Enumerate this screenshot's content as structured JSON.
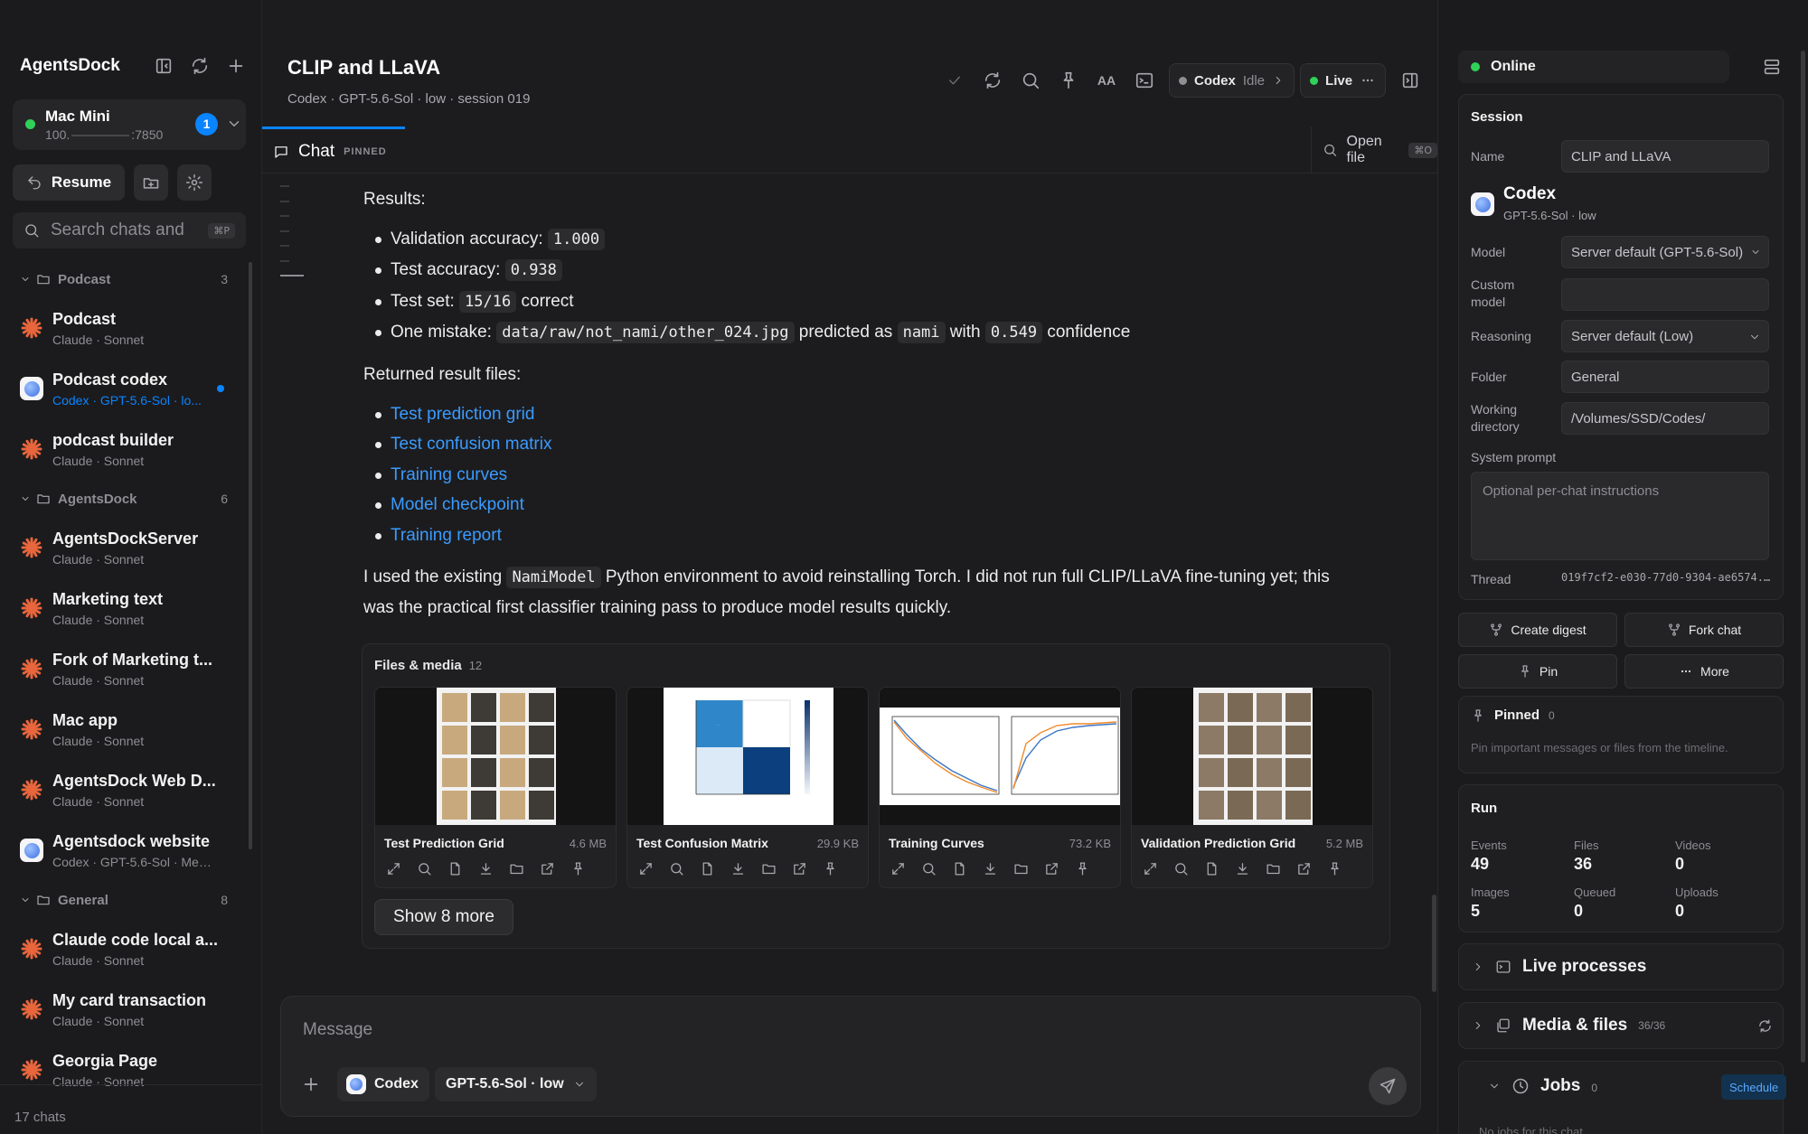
{
  "sidebar": {
    "brand": "AgentsDock",
    "device": {
      "name": "Mac Mini",
      "addr_prefix": "100.",
      "addr_suffix": ":7850",
      "badge": "1"
    },
    "resume_label": "Resume",
    "search_placeholder": "Search chats and",
    "search_kbd": "⌘P",
    "groups": [
      {
        "name": "Podcast",
        "count": "3",
        "chats": [
          {
            "title": "Podcast",
            "sub": "Claude · Sonnet",
            "agent": "claude"
          },
          {
            "title": "Podcast codex",
            "sub": "Codex · GPT-5.6-Sol · lo...",
            "agent": "codex",
            "active": true
          },
          {
            "title": "podcast builder",
            "sub": "Claude · Sonnet",
            "agent": "claude"
          }
        ]
      },
      {
        "name": "AgentsDock",
        "count": "6",
        "chats": [
          {
            "title": "AgentsDockServer",
            "sub": "Claude · Sonnet",
            "agent": "claude"
          },
          {
            "title": "Marketing text",
            "sub": "Claude · Sonnet",
            "agent": "claude"
          },
          {
            "title": "Fork of Marketing t...",
            "sub": "Claude · Sonnet",
            "agent": "claude"
          },
          {
            "title": "Mac app",
            "sub": "Claude · Sonnet",
            "agent": "claude"
          },
          {
            "title": "AgentsDock Web D...",
            "sub": "Claude · Sonnet",
            "agent": "claude"
          },
          {
            "title": "Agentsdock website",
            "sub": "Codex · GPT-5.6-Sol · Medi...",
            "agent": "codex"
          }
        ]
      },
      {
        "name": "General",
        "count": "8",
        "chats": [
          {
            "title": "Claude code local a...",
            "sub": "Claude · Sonnet",
            "agent": "claude"
          },
          {
            "title": "My card transaction",
            "sub": "Claude · Sonnet",
            "agent": "claude"
          },
          {
            "title": "Georgia Page",
            "sub": "Claude · Sonnet",
            "agent": "claude"
          }
        ]
      }
    ],
    "footer": "17 chats"
  },
  "header": {
    "title": "CLIP and LLaVA",
    "subtitle": "Codex · GPT-5.6-Sol · low · session 019",
    "codex_label": "Codex",
    "codex_state": "Idle",
    "live_label": "Live",
    "font_size_label": "AA"
  },
  "tabs": {
    "chat_label": "Chat",
    "chat_pinned": "PINNED",
    "open_file": "Open file",
    "open_file_kbd": "⌘O"
  },
  "message": {
    "results_heading": "Results:",
    "results": [
      {
        "label": "Validation accuracy: ",
        "code": "1.000"
      },
      {
        "label": "Test accuracy: ",
        "code": "0.938"
      },
      {
        "label": "Test set: ",
        "code": "15/16",
        "after": " correct"
      }
    ],
    "mistake": {
      "prefix": "One mistake: ",
      "path": "data/raw/not_nami/other_024.jpg",
      "mid": " predicted as ",
      "cls": "nami",
      "with": " with ",
      "conf": "0.549",
      "suffix": " confidence"
    },
    "returned_heading": "Returned result files:",
    "links": [
      "Test prediction grid",
      "Test confusion matrix",
      "Training curves",
      "Model checkpoint",
      "Training report"
    ],
    "para_prefix": "I used the existing ",
    "para_code": "NamiModel",
    "para_line1": " Python environment to avoid reinstalling Torch. I did not run full CLIP/LLaVA fine-tuning yet; this",
    "para_line2": "was the practical first classifier training pass to produce model results quickly."
  },
  "files": {
    "title": "Files & media",
    "count": "12",
    "cards": [
      {
        "name": "Test Prediction Grid",
        "size": "4.6 MB"
      },
      {
        "name": "Test Confusion Matrix",
        "size": "29.9 KB"
      },
      {
        "name": "Training Curves",
        "size": "73.2 KB"
      },
      {
        "name": "Validation Prediction Grid",
        "size": "5.2 MB"
      }
    ],
    "show_more": "Show 8 more"
  },
  "composer": {
    "placeholder": "Message",
    "agent": "Codex",
    "model": "GPT-5.6-Sol · low"
  },
  "panel": {
    "status": "Online",
    "session_title": "Session",
    "name_label": "Name",
    "name_value": "CLIP and LLaVA",
    "agent_name": "Codex",
    "agent_sub": "GPT-5.6-Sol · low",
    "model_label": "Model",
    "model_value": "Server default (GPT-5.6-Sol)",
    "custom_model_label": "Custom model",
    "custom_model_value": "",
    "reasoning_label": "Reasoning",
    "reasoning_value": "Server default (Low)",
    "folder_label": "Folder",
    "folder_value": "General",
    "wd_label": "Working directory",
    "wd_value": "/Volumes/SSD/Codes/",
    "sp_label": "System prompt",
    "sp_placeholder": "Optional per-chat instructions",
    "thread_label": "Thread",
    "thread_value": "019f7cf2-e030-77d0-9304-ae6574...",
    "btn_digest": "Create digest",
    "btn_fork": "Fork chat",
    "btn_pin": "Pin",
    "btn_more": "More",
    "pinned_title": "Pinned",
    "pinned_count": "0",
    "pinned_hint": "Pin important messages or files from the timeline.",
    "run_title": "Run",
    "stats": [
      {
        "label": "Events",
        "value": "49"
      },
      {
        "label": "Files",
        "value": "36"
      },
      {
        "label": "Videos",
        "value": "0"
      },
      {
        "label": "Images",
        "value": "5"
      },
      {
        "label": "Queued",
        "value": "0"
      },
      {
        "label": "Uploads",
        "value": "0"
      }
    ],
    "live_processes": "Live processes",
    "media_files": "Media & files",
    "media_count": "36/36",
    "jobs": "Jobs",
    "jobs_count": "0",
    "schedule": "Schedule",
    "no_jobs": "No jobs for this chat"
  },
  "colors": {
    "accent": "#0a84ff",
    "online": "#30d158",
    "link": "#3a9bff",
    "claude": "#e8663d"
  }
}
